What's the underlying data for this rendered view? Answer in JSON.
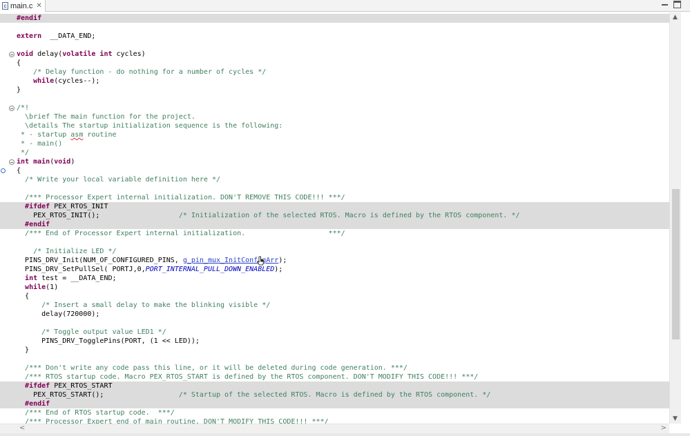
{
  "tab": {
    "icon_label": "c",
    "title": "main.c",
    "close": "✕"
  },
  "scrollbars": {
    "up": "▲",
    "down": "▼",
    "left": "<",
    "right": ">"
  },
  "code": {
    "lines": [
      {
        "hl": true,
        "t": [
          [
            "kw",
            "#endif"
          ]
        ]
      },
      {
        "t": []
      },
      {
        "t": [
          [
            "kw",
            "extern"
          ],
          [
            "",
            "  __DATA_END;"
          ]
        ]
      },
      {
        "t": []
      },
      {
        "fold": true,
        "t": [
          [
            "kw",
            "void"
          ],
          [
            "",
            " delay("
          ],
          [
            "kw",
            "volatile int"
          ],
          [
            "",
            " cycles)"
          ]
        ]
      },
      {
        "t": [
          [
            "",
            "{"
          ]
        ]
      },
      {
        "t": [
          [
            "",
            "    "
          ],
          [
            "cm",
            "/* Delay function - do nothing for a number of cycles */"
          ]
        ]
      },
      {
        "t": [
          [
            "",
            "    "
          ],
          [
            "kw",
            "while"
          ],
          [
            "",
            "(cycles--);"
          ]
        ]
      },
      {
        "t": [
          [
            "",
            "}"
          ]
        ]
      },
      {
        "t": []
      },
      {
        "fold": true,
        "t": [
          [
            "cm",
            "/*!"
          ]
        ]
      },
      {
        "t": [
          [
            "cm",
            "  \\brief The main function for the project."
          ]
        ]
      },
      {
        "t": [
          [
            "cm",
            "  \\details The startup initialization sequence is the following:"
          ]
        ]
      },
      {
        "t": [
          [
            "cm",
            " * - startup "
          ],
          [
            "cm sq",
            "asm"
          ],
          [
            "cm",
            " routine"
          ]
        ]
      },
      {
        "t": [
          [
            "cm",
            " * - main()"
          ]
        ]
      },
      {
        "t": [
          [
            "cm",
            " */"
          ]
        ]
      },
      {
        "fold": true,
        "t": [
          [
            "kw",
            "int"
          ],
          [
            "",
            " "
          ],
          [
            "kw",
            "main"
          ],
          [
            "",
            "("
          ],
          [
            "kw",
            "void"
          ],
          [
            "",
            ")"
          ]
        ]
      },
      {
        "marker": true,
        "t": [
          [
            "",
            "{"
          ]
        ]
      },
      {
        "t": [
          [
            "",
            "  "
          ],
          [
            "cm",
            "/* Write your local variable definition here */"
          ]
        ]
      },
      {
        "t": []
      },
      {
        "t": [
          [
            "",
            "  "
          ],
          [
            "cm",
            "/*** Processor Expert internal initialization. DON'T REMOVE THIS CODE!!! ***/"
          ]
        ]
      },
      {
        "hl": true,
        "t": [
          [
            "",
            "  "
          ],
          [
            "kw",
            "#ifdef"
          ],
          [
            "",
            " PEX_RTOS_INIT"
          ]
        ]
      },
      {
        "hl": true,
        "t": [
          [
            "",
            "    PEX_RTOS_INIT();                   "
          ],
          [
            "cm",
            "/* Initialization of the selected RTOS. Macro is defined by the RTOS component. */"
          ]
        ]
      },
      {
        "hl": true,
        "t": [
          [
            "",
            "  "
          ],
          [
            "kw",
            "#endif"
          ]
        ]
      },
      {
        "t": [
          [
            "",
            "  "
          ],
          [
            "cm",
            "/*** End of Processor Expert internal initialization.                    ***/"
          ]
        ]
      },
      {
        "t": []
      },
      {
        "t": [
          [
            "",
            "    "
          ],
          [
            "cm",
            "/* Initialize LED */"
          ]
        ]
      },
      {
        "t": [
          [
            "",
            "  PINS_DRV_Init(NUM_OF_CONFIGURED_PINS, "
          ],
          [
            "lnk",
            "g_pin_mux_InitConfigArr"
          ],
          [
            "",
            ");"
          ]
        ]
      },
      {
        "t": [
          [
            "",
            "  PINS_DRV_SetPullSel( PORTJ,0,"
          ],
          [
            "en",
            "PORT_INTERNAL_PULL_DOWN_ENABLED"
          ],
          [
            "",
            ");"
          ]
        ]
      },
      {
        "t": [
          [
            "",
            "  "
          ],
          [
            "kw",
            "int"
          ],
          [
            "",
            " test = __DATA_END;"
          ]
        ]
      },
      {
        "t": [
          [
            "",
            "  "
          ],
          [
            "kw",
            "while"
          ],
          [
            "",
            "(1)"
          ]
        ]
      },
      {
        "t": [
          [
            "",
            "  {"
          ]
        ]
      },
      {
        "t": [
          [
            "",
            "      "
          ],
          [
            "cm",
            "/* Insert a small delay to make the blinking visible */"
          ]
        ]
      },
      {
        "t": [
          [
            "",
            "      delay(720000);"
          ]
        ]
      },
      {
        "t": []
      },
      {
        "t": [
          [
            "",
            "      "
          ],
          [
            "cm",
            "/* Toggle output value LED1 */"
          ]
        ]
      },
      {
        "t": [
          [
            "",
            "      PINS_DRV_TogglePins(PORT, (1 << LED));"
          ]
        ]
      },
      {
        "t": [
          [
            "",
            "  }"
          ]
        ]
      },
      {
        "t": []
      },
      {
        "t": [
          [
            "",
            "  "
          ],
          [
            "cm",
            "/*** Don't write any code pass this line, or it will be deleted during code generation. ***/"
          ]
        ]
      },
      {
        "t": [
          [
            "",
            "  "
          ],
          [
            "cm",
            "/*** RTOS startup code. Macro PEX_RTOS_START is defined by the RTOS component. DON'T MODIFY THIS CODE!!! ***/"
          ]
        ]
      },
      {
        "hl": true,
        "t": [
          [
            "",
            "  "
          ],
          [
            "kw",
            "#ifdef"
          ],
          [
            "",
            " PEX_RTOS_START"
          ]
        ]
      },
      {
        "hl": true,
        "t": [
          [
            "",
            "    PEX_RTOS_START();                  "
          ],
          [
            "cm",
            "/* Startup of the selected RTOS. Macro is defined by the RTOS component. */"
          ]
        ]
      },
      {
        "hl": true,
        "t": [
          [
            "",
            "  "
          ],
          [
            "kw",
            "#endif"
          ]
        ]
      },
      {
        "t": [
          [
            "",
            "  "
          ],
          [
            "cm",
            "/*** End of RTOS startup code.  ***/"
          ]
        ]
      },
      {
        "t": [
          [
            "",
            "  "
          ],
          [
            "cm",
            "/*** Processor Expert end of main routine. DON'T MODIFY THIS CODE!!! ***/"
          ]
        ]
      }
    ]
  }
}
